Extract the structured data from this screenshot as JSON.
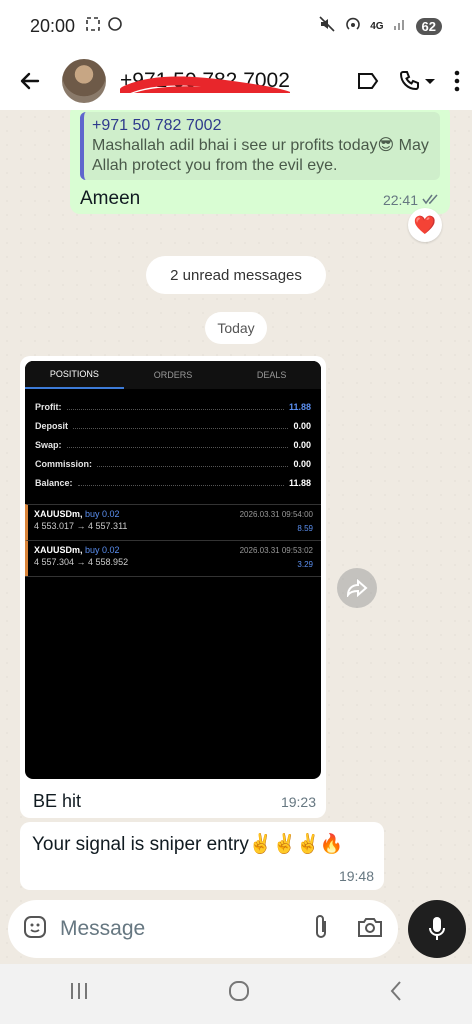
{
  "status_bar": {
    "time": "20:00",
    "network": "4G",
    "battery": "62"
  },
  "header": {
    "contact_name": "+971 50 782 7002"
  },
  "messages": {
    "reply_quote": {
      "number": "+971 50 782 7002",
      "text": "Mashallah adil bhai i see ur profits today😎 May Allah protect you from the evil eye."
    },
    "out_1": {
      "text": "Ameen",
      "time": "22:41"
    },
    "reaction": "❤️",
    "unread": "2 unread messages",
    "date_divider": "Today",
    "image_msg": {
      "caption": "BE hit",
      "time": "19:23"
    },
    "in_2": {
      "text": "Your signal is sniper entry✌️✌️✌️🔥",
      "time": "19:48"
    }
  },
  "trading_screenshot": {
    "tabs": [
      "POSITIONS",
      "ORDERS",
      "DEALS"
    ],
    "summary": [
      {
        "label": "Profit:",
        "value": "11.88"
      },
      {
        "label": "Deposit",
        "value": "0.00"
      },
      {
        "label": "Swap:",
        "value": "0.00"
      },
      {
        "label": "Commission:",
        "value": "0.00"
      },
      {
        "label": "Balance:",
        "value": "11.88"
      }
    ],
    "trades": [
      {
        "symbol": "XAUUSDm,",
        "direction": "buy 0.02",
        "prices": "4 553.017 → 4 557.311",
        "date": "2026.03.31 09:54:00",
        "profit": "8.59"
      },
      {
        "symbol": "XAUUSDm,",
        "direction": "buy 0.02",
        "prices": "4 557.304 → 4 558.952",
        "date": "2026.03.31 09:53:02",
        "profit": "3.29"
      }
    ]
  },
  "input": {
    "placeholder": "Message"
  },
  "colors": {
    "outgoing_bubble": "#d9fdd3",
    "incoming_bubble": "#ffffff",
    "chat_background": "#efeae2",
    "profit_blue": "#5b8ff0"
  },
  "icons": {
    "back": "arrow-left-icon",
    "label": "label-icon",
    "call": "phone-icon",
    "more": "kebab-icon",
    "sticker": "sticker-icon",
    "attach": "paperclip-icon",
    "camera": "camera-icon",
    "mic": "mic-icon",
    "forward": "forward-icon"
  }
}
